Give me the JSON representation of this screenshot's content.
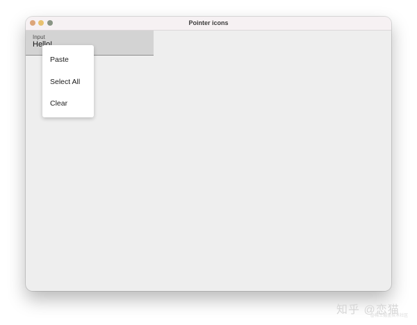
{
  "window": {
    "title": "Pointer icons",
    "traffic_lights": {
      "close_color": "#dca579",
      "minimize_color": "#e8c16f",
      "maximize_color": "#8a9585"
    },
    "background_color": "#eeeeee"
  },
  "input": {
    "label": "Input",
    "value": "Hello!"
  },
  "context_menu": {
    "items": [
      {
        "label": "Paste"
      },
      {
        "label": "Select All"
      },
      {
        "label": "Clear"
      }
    ]
  },
  "watermark": {
    "text": "知乎 @恋猫",
    "subtext": "@稀土掘金技术社区"
  }
}
